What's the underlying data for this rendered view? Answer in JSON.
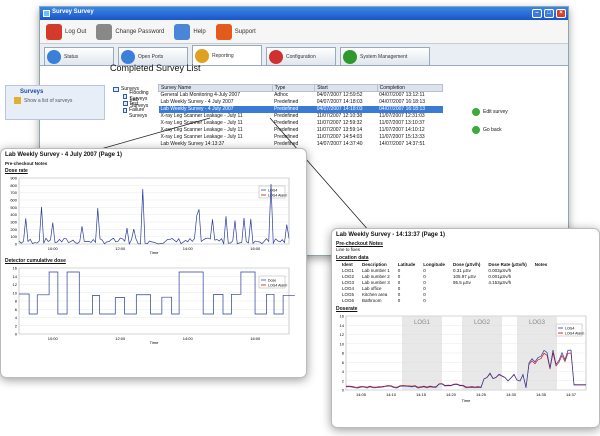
{
  "window": {
    "title": "Survey Survey"
  },
  "toolbar": [
    {
      "label": "Log Out",
      "color": "#d23a2a"
    },
    {
      "label": "Change Password",
      "color": "#888888"
    },
    {
      "label": "Help",
      "color": "#4a86d8"
    },
    {
      "label": "Support",
      "color": "#e25b1a"
    }
  ],
  "tabs": [
    {
      "label": "Status",
      "color": "#3a7fd9"
    },
    {
      "label": "Open Ports",
      "color": "#3a7fd9"
    },
    {
      "label": "Reporting",
      "color": "#e0a020",
      "active": true
    },
    {
      "label": "Configuration",
      "color": "#d03030"
    },
    {
      "label": "System Management",
      "color": "#2e9a2e"
    }
  ],
  "heading": "Completed Survey List",
  "left_panel": {
    "title": "Surveys",
    "item": "Show a list of surveys"
  },
  "tree": {
    "root": "Surveys",
    "items": [
      "Flooding Surveys",
      "Lab Surveys",
      "Test Failure Surveys"
    ]
  },
  "grid": {
    "headers": [
      "Survey Name",
      "Type",
      "Start",
      "Completion"
    ],
    "rows": [
      [
        "General Lab Monitoring 4-July 2007",
        "Adhoc",
        "04/07/2007 12:59:52",
        "04/07/2007 13:12:11"
      ],
      [
        "Lab Weekly Survey - 4 July 2007",
        "Predefined",
        "04/07/2007 14:18:03",
        "04/07/2007 16:18:13"
      ],
      [
        "Lab Weekly Survey - 4 July 2007",
        "Predefined",
        "04/07/2007 14:18:03",
        "04/07/2007 16:18:13"
      ],
      [
        "X-ray Leg Scanner Leakage - July 11",
        "Predefined",
        "11/07/2007 12:10:38",
        "11/07/2007 12:31:03"
      ],
      [
        "X-ray Leg Scanner Leakage - July 11",
        "Predefined",
        "11/07/2007 12:59:32",
        "11/07/2007 13:10:37"
      ],
      [
        "X-ray Leg Scanner Leakage - July 11",
        "Predefined",
        "11/07/2007 13:59:14",
        "11/07/2007 14:10:12"
      ],
      [
        "X-ray Leg Scanner Leakage - July 11",
        "Predefined",
        "11/07/2007 14:54:03",
        "11/07/2007 15:13:33"
      ],
      [
        "Lab Weekly Survey 14:13:37",
        "Predefined",
        "14/07/2007 14:37:40",
        "14/07/2007 14:37:51"
      ]
    ],
    "selected_row": 2
  },
  "right_links": [
    "Edit survey",
    "Go back"
  ],
  "report1": {
    "title": "Lab Weekly Survey - 4 July 2007 (Page 1)",
    "notes_title": "Pre-checkout Notes",
    "section1": "Dose rate",
    "section2": "Detector cumulative dose",
    "legend1": [
      "LOG4",
      "LOG4 Alarm"
    ],
    "legend2": [
      "Dose",
      "LOG4 Alarm"
    ],
    "xticks": [
      "10:00",
      "12:00",
      "14:00",
      "16:00"
    ],
    "xlabel": "Time",
    "yticks1": [
      "900",
      "800",
      "700",
      "600",
      "500",
      "400",
      "300",
      "200",
      "100",
      "0"
    ],
    "yticks2": [
      "16",
      "14",
      "12",
      "10",
      "8",
      "6",
      "4",
      "2",
      "0"
    ]
  },
  "report2": {
    "title": "Lab Weekly Survey - 14:13:37 (Page 1)",
    "notes_title": "Pre-checkout Notes",
    "notes": "Line to fixes",
    "section1": "Location data",
    "section2": "Doserate",
    "table_headers": [
      "Ident",
      "Description",
      "Latitude",
      "Longitude",
      "Dose (µSv/h)",
      "Dose Rate (µSv/h)",
      "Notes"
    ],
    "table_rows": [
      [
        "LOG1",
        "Lab number 1",
        "0",
        "0",
        "0.31 µSv",
        "0.003µSv/h",
        ""
      ],
      [
        "LOG2",
        "Lab number 2",
        "0",
        "0",
        "105.97 µSv",
        "0.001µSv/h",
        ""
      ],
      [
        "LOG3",
        "Lab number 3",
        "0",
        "0",
        "95.5 µSv",
        "4.153µSv/h",
        ""
      ],
      [
        "LOG4",
        "Lab office",
        "0",
        "0",
        "",
        "",
        ""
      ],
      [
        "LOG5",
        "Kitchen area",
        "0",
        "0",
        "",
        "",
        ""
      ],
      [
        "LOG6",
        "Bathroom",
        "0",
        "0",
        "",
        "",
        ""
      ]
    ],
    "zones": [
      "LOG1",
      "LOG2",
      "LOG3"
    ],
    "legend": [
      "LOG4",
      "LOG4 Alarm"
    ],
    "xticks": [
      "14:05",
      "14:10",
      "14:15",
      "14:20",
      "14:25",
      "14:30",
      "14:35",
      "14:37"
    ],
    "xlabel": "Time",
    "yticks": [
      "16",
      "14",
      "12",
      "10",
      "8",
      "6",
      "4",
      "2",
      "0"
    ]
  }
}
